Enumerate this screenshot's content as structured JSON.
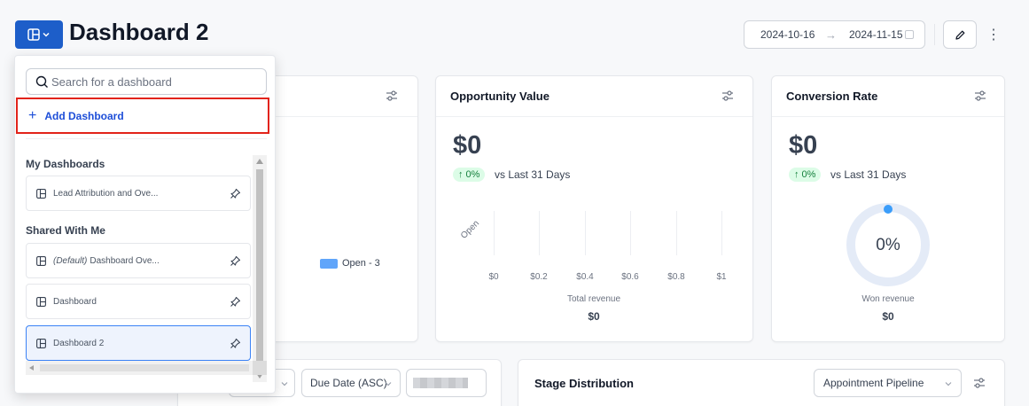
{
  "header": {
    "title": "Dashboard 2",
    "date_start": "2024-10-16",
    "date_arrow": "→",
    "date_end": "2024-11-15",
    "more_glyph": "⋮"
  },
  "cards": {
    "first": {
      "legend_label": "Open - 3"
    },
    "opportunity": {
      "title": "Opportunity Value",
      "value": "$0",
      "change": "0%",
      "change_arrow": "↑",
      "comparison": "vs Last 31 Days",
      "y_category": "Open",
      "x_ticks": [
        "$0",
        "$0.2",
        "$0.4",
        "$0.6",
        "$0.8",
        "$1"
      ],
      "footer_label": "Total revenue",
      "footer_value": "$0"
    },
    "conversion": {
      "title": "Conversion Rate",
      "value": "$0",
      "change": "0%",
      "change_arrow": "↑",
      "comparison": "vs Last 31 Days",
      "donut_value": "0%",
      "footer_label": "Won revenue",
      "footer_value": "$0"
    },
    "stage": {
      "title": "Stage Distribution",
      "pipeline_select": "Appointment Pipeline"
    }
  },
  "bottom_left": {
    "sort_select": "Due Date (ASC)"
  },
  "dropdown": {
    "search_placeholder": "Search for a dashboard",
    "add_label": "Add Dashboard",
    "my_section": "My Dashboards",
    "shared_section": "Shared With Me",
    "my_items": [
      {
        "label": "Lead Attribution and Ove..."
      }
    ],
    "shared_items": [
      {
        "prefix": "(Default)",
        "label": "Dashboard Ove..."
      },
      {
        "prefix": "",
        "label": "Dashboard"
      },
      {
        "prefix": "",
        "label": "Dashboard 2",
        "selected": true
      }
    ]
  },
  "colors": {
    "primary": "#1d5ec9",
    "highlight_border": "#e2231a",
    "badge_bg": "#dcfce7",
    "badge_text": "#15803d",
    "legend_swatch": "#60a5fa",
    "donut_track": "#e4ebf7",
    "donut_dot": "#3b9dfa"
  },
  "icons": [
    "layout-icon",
    "chevron-down-icon",
    "calendar-icon",
    "pencil-icon",
    "more-vertical-icon",
    "filter-icon",
    "search-icon",
    "plus-icon",
    "pin-icon",
    "arrow-up-icon"
  ]
}
